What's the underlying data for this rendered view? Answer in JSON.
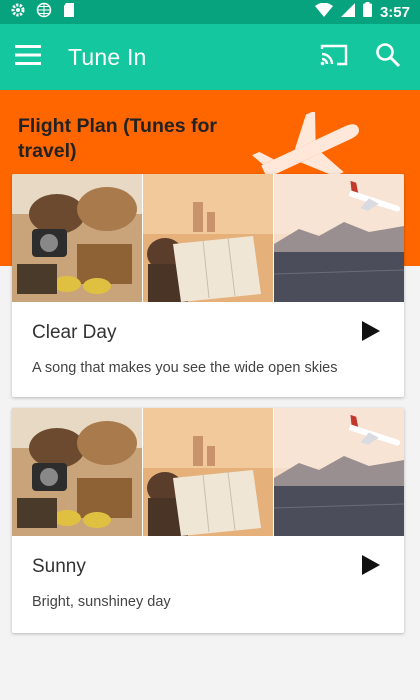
{
  "status_bar": {
    "time": "3:57",
    "icons": [
      "gear-icon",
      "globe-icon",
      "sd-card-icon",
      "wifi-icon",
      "signal-icon",
      "battery-icon"
    ]
  },
  "app_bar": {
    "title": "Tune In",
    "icons": [
      "menu-icon",
      "cast-icon",
      "search-icon"
    ]
  },
  "section": {
    "title": "Flight Plan (Tunes for travel)"
  },
  "tracks": [
    {
      "title": "Clear Day",
      "description": "A song that makes you see the wide open skies",
      "action_icon": "play-icon"
    },
    {
      "title": "Sunny",
      "description": "Bright, sunshiney day",
      "action_icon": "play-icon"
    }
  ],
  "colors": {
    "status_bar": "#07a37f",
    "app_bar": "#15c79e",
    "header": "#ff6600"
  }
}
